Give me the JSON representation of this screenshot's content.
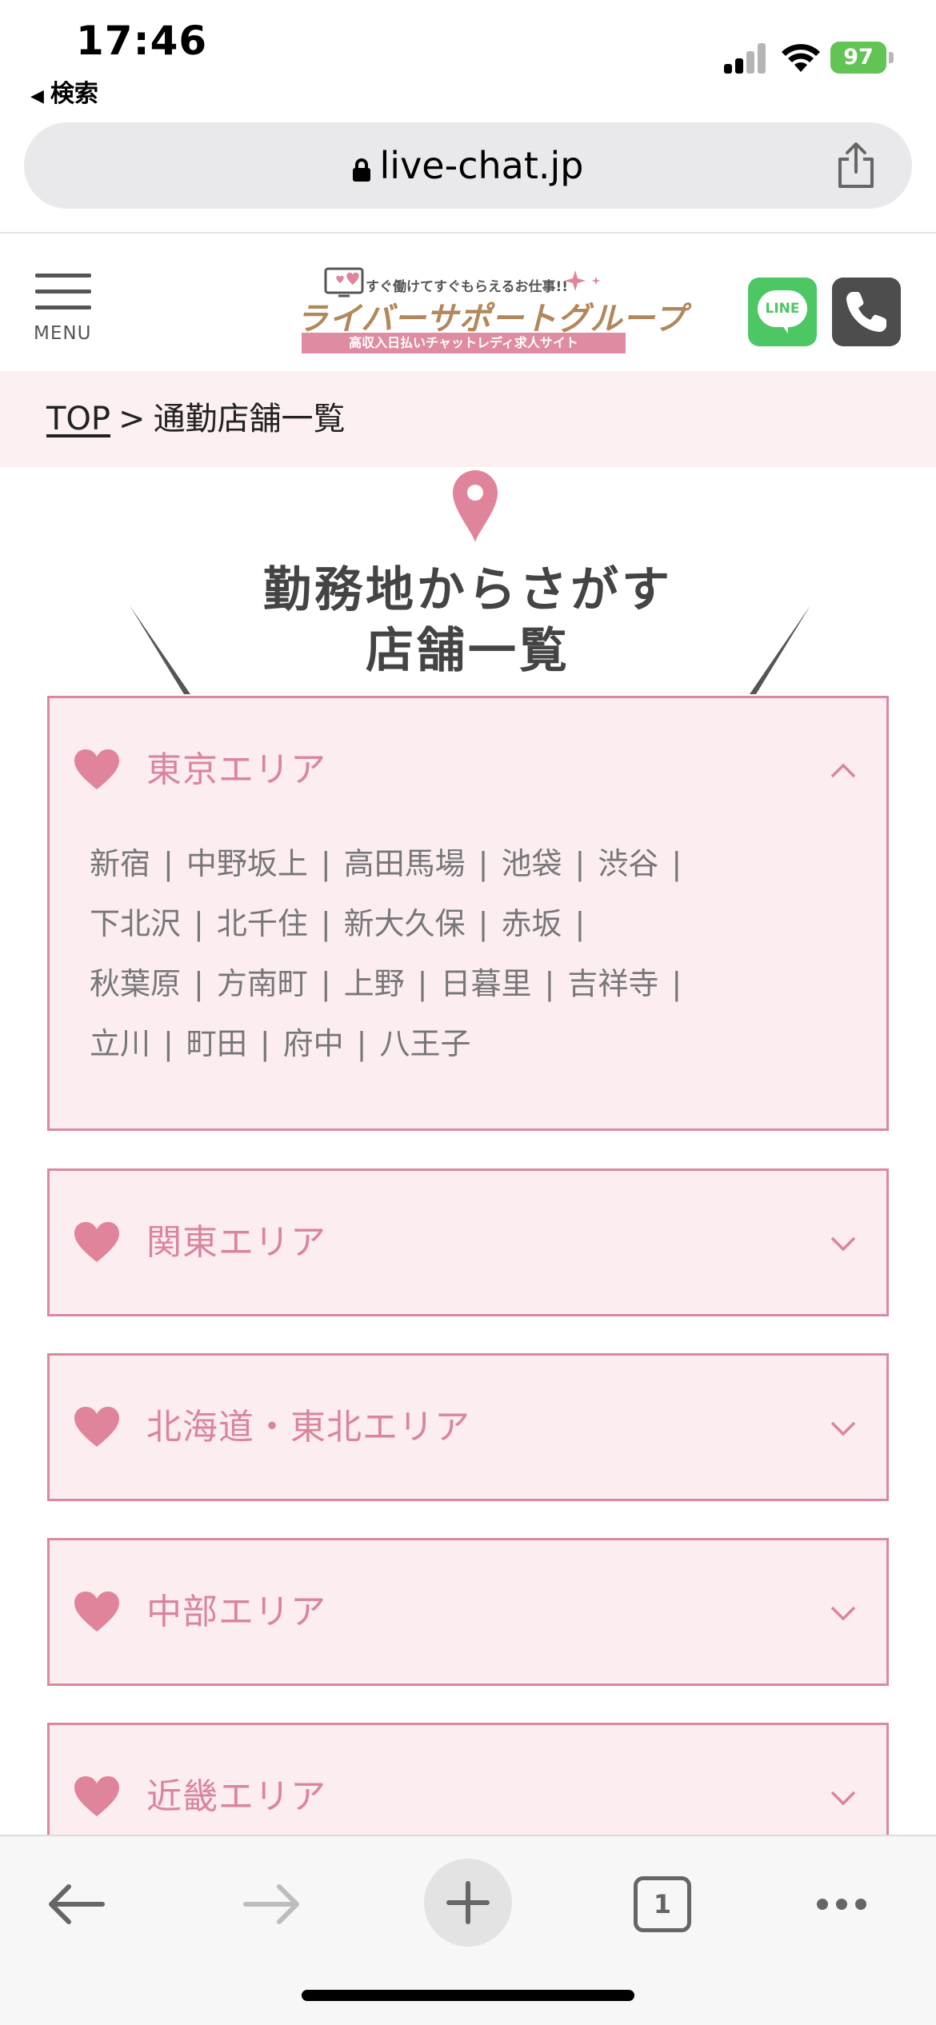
{
  "status_bar": {
    "time": "17:46",
    "back_label": "検索",
    "battery": "97"
  },
  "browser": {
    "url": "live-chat.jp"
  },
  "header": {
    "menu_label": "MENU",
    "logo_tagline": "すぐ働けてすぐもらえるお仕事!!",
    "logo_main": "ライバーサポートグループ",
    "logo_sub": "高収入日払いチャットレディ求人サイト",
    "line_label": "LINE"
  },
  "breadcrumb": {
    "top": "TOP",
    "separator": ">",
    "current": "通勤店舗一覧"
  },
  "section": {
    "title_line1": "勤務地からさがす",
    "title_line2": "店舗一覧"
  },
  "areas": [
    {
      "title": "東京エリア",
      "expanded": true,
      "station_lines": [
        [
          "新宿",
          "中野坂上",
          "高田馬場",
          "池袋",
          "渋谷"
        ],
        [
          "下北沢",
          "北千住",
          "新大久保",
          "赤坂"
        ],
        [
          "秋葉原",
          "方南町",
          "上野",
          "日暮里",
          "吉祥寺"
        ],
        [
          "立川",
          "町田",
          "府中",
          "八王子"
        ]
      ]
    },
    {
      "title": "関東エリア",
      "expanded": false
    },
    {
      "title": "北海道・東北エリア",
      "expanded": false
    },
    {
      "title": "中部エリア",
      "expanded": false
    },
    {
      "title": "近畿エリア",
      "expanded": false
    }
  ],
  "toolbar": {
    "tab_count": "1"
  },
  "colors": {
    "accent_pink": "#d9869c",
    "box_bg": "#fcedf0",
    "breadcrumb_bg": "#fcf0f1",
    "line_green": "#4cc764",
    "battery_green": "#61c454"
  }
}
